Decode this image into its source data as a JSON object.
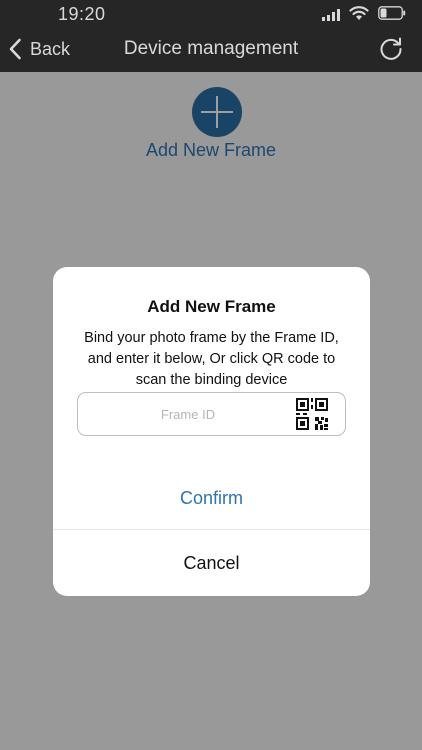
{
  "status_bar": {
    "time": "19:20",
    "icons": [
      "signal-icon",
      "wifi-icon",
      "battery-icon"
    ],
    "battery_level": 0.3
  },
  "nav": {
    "back_label": "Back",
    "title": "Device management",
    "back_icon": "chevron-left-icon",
    "refresh_icon": "refresh-icon"
  },
  "content": {
    "add_icon": "plus-icon",
    "add_label": "Add New Frame"
  },
  "dialog": {
    "title": "Add New Frame",
    "message": "Bind your photo frame by the Frame ID, and enter it below, Or click QR code to scan the binding device",
    "input_placeholder": "Frame ID",
    "input_value": "",
    "qr_icon": "qr-code-icon",
    "confirm_label": "Confirm",
    "cancel_label": "Cancel"
  },
  "colors": {
    "accent": "#2f74b0",
    "nav_background": "#262626",
    "overlay": "rgba(0,0,0,0.38)"
  }
}
